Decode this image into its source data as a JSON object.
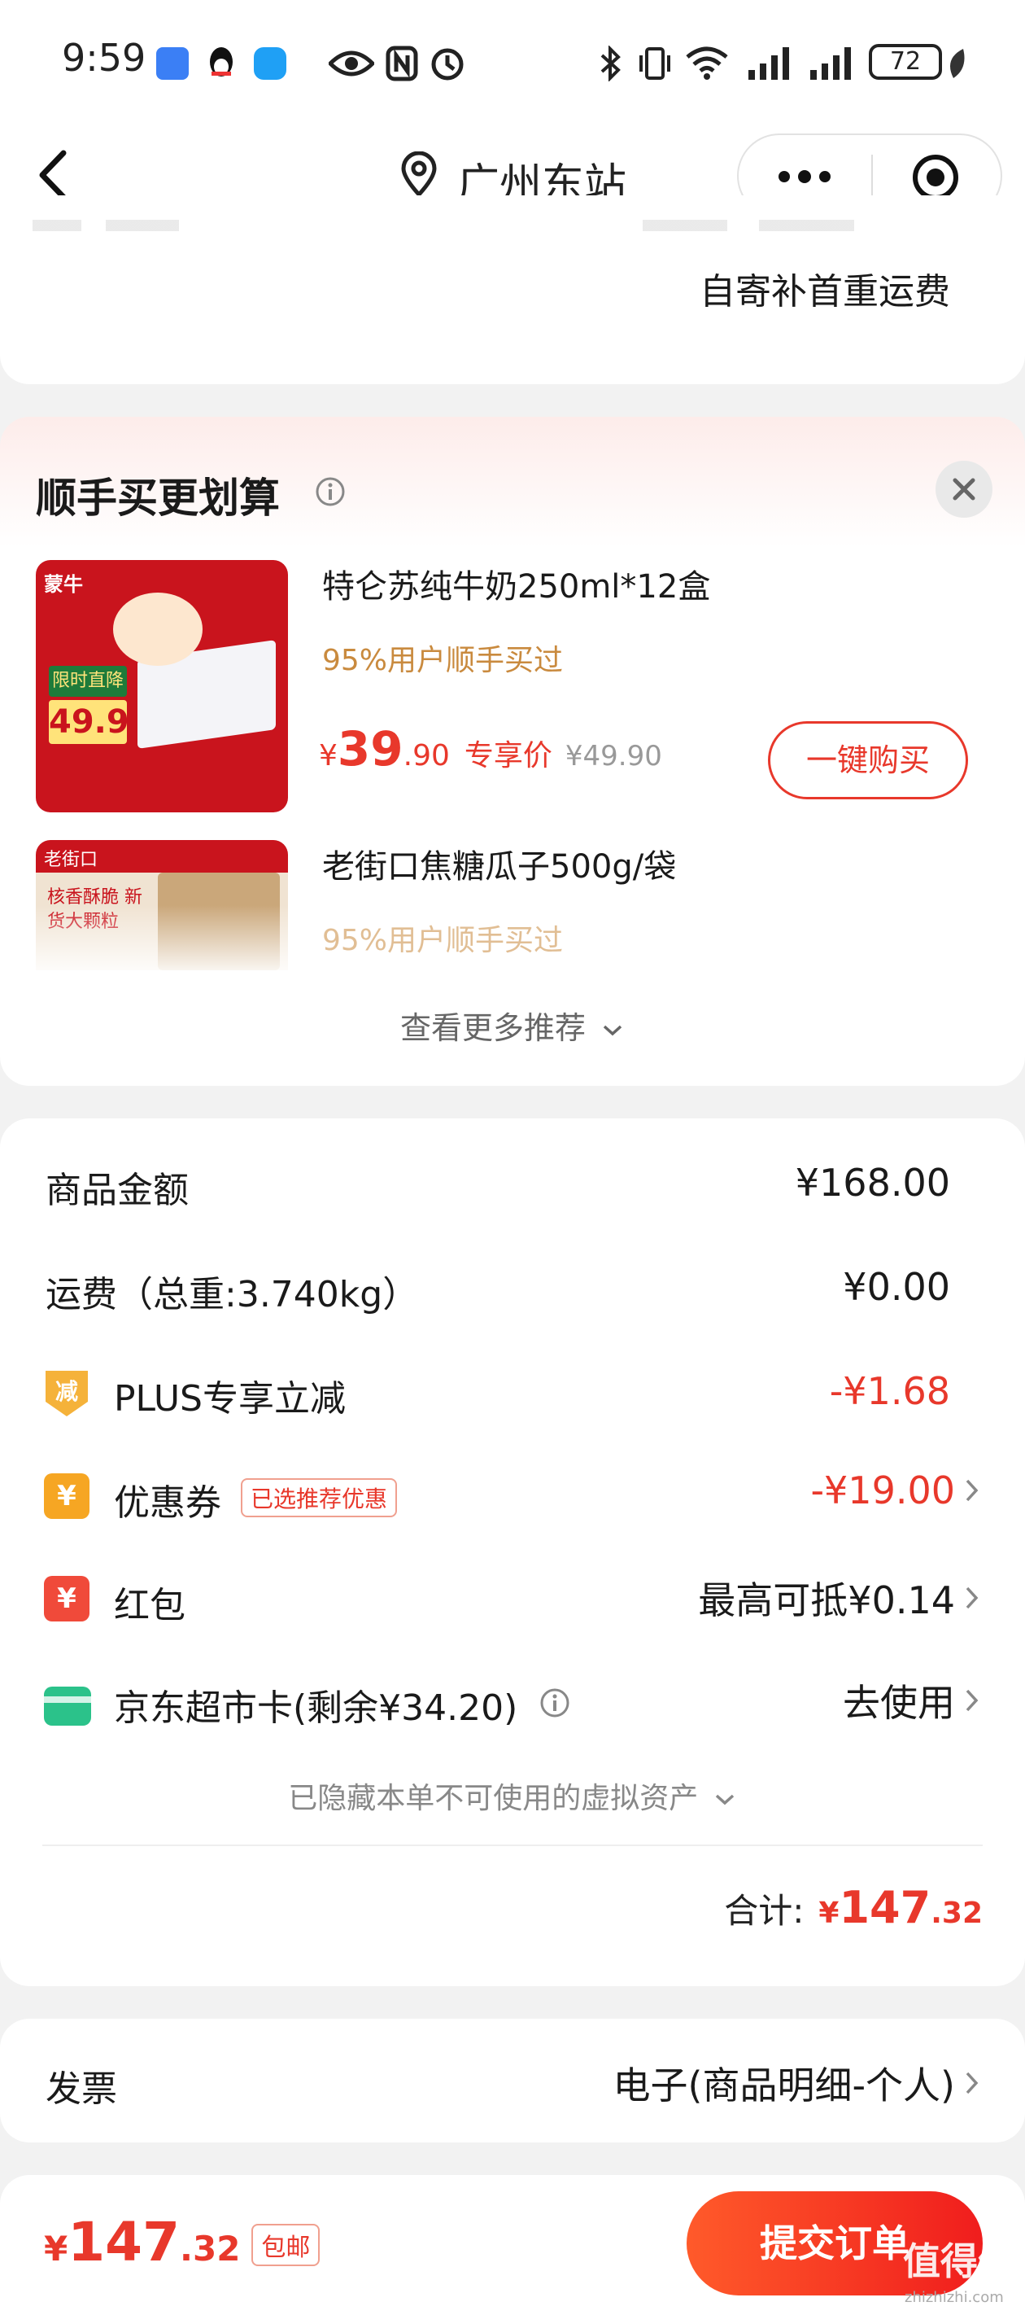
{
  "status_bar": {
    "time": "9:59",
    "battery": "72",
    "icons": [
      "chat-badge-icon",
      "qq-icon",
      "message-icon",
      "eye-icon",
      "nfc-icon",
      "alarm-icon",
      "bluetooth-icon",
      "vibrate-icon",
      "wifi-icon",
      "signal-icon",
      "signal-icon",
      "leaf-icon"
    ]
  },
  "nav": {
    "location": "广州东站"
  },
  "shipping": {
    "note": "自寄补首重运费"
  },
  "recommend": {
    "title": "顺手买更划算",
    "more_label": "查看更多推荐",
    "products": [
      {
        "name": "特仑苏纯牛奶250ml*12盒",
        "social": "95%用户顺手买过",
        "currency": "¥",
        "price_int": "39",
        "price_dec": ".90",
        "exclusive_label": "专享价",
        "orig_price": "¥49.90",
        "buy_label": "一键购买",
        "img_badge_brand": "蒙牛",
        "img_badge_sale": "限时直降",
        "img_badge_price": "49.9"
      },
      {
        "name": "老街口焦糖瓜子500g/袋",
        "social": "95%用户顺手买过",
        "img_badge_brand": "老街口",
        "img_badge_sale": "核香酥脆 新货大颗粒"
      }
    ]
  },
  "summary": {
    "goods_label": "商品金额",
    "goods_value": "¥168.00",
    "freight_label": "运费（总重:3.740kg）",
    "freight_value": "¥0.00",
    "plus_label": "PLUS专享立减",
    "plus_icon_char": "减",
    "plus_value": "-¥1.68",
    "coupon_label": "优惠券",
    "coupon_tag": "已选推荐优惠",
    "coupon_icon_char": "¥",
    "coupon_value": "-¥19.00",
    "redpacket_label": "红包",
    "redpacket_icon_char": "¥",
    "redpacket_value": "最高可抵¥0.14",
    "card_label": "京东超市卡(剩余¥34.20)",
    "card_value": "去使用",
    "hidden_note": "已隐藏本单不可使用的虚拟资产",
    "total_label": "合计:",
    "total_currency": "¥",
    "total_int": "147",
    "total_dec": ".32"
  },
  "invoice": {
    "label": "发票",
    "value": "电子(商品明细-个人)"
  },
  "bottom": {
    "currency": "¥",
    "price_int": "147",
    "price_dec": ".32",
    "free_ship_tag": "包邮",
    "submit_label": "提交订单",
    "watermark": "值得值",
    "watermark_url": "zhizhizhi.com"
  },
  "colors": {
    "accent_red": "#e8382b",
    "submit_gradient_start": "#ff5a2a",
    "submit_gradient_end": "#f01d1d",
    "social_gold": "#c98a3e"
  }
}
